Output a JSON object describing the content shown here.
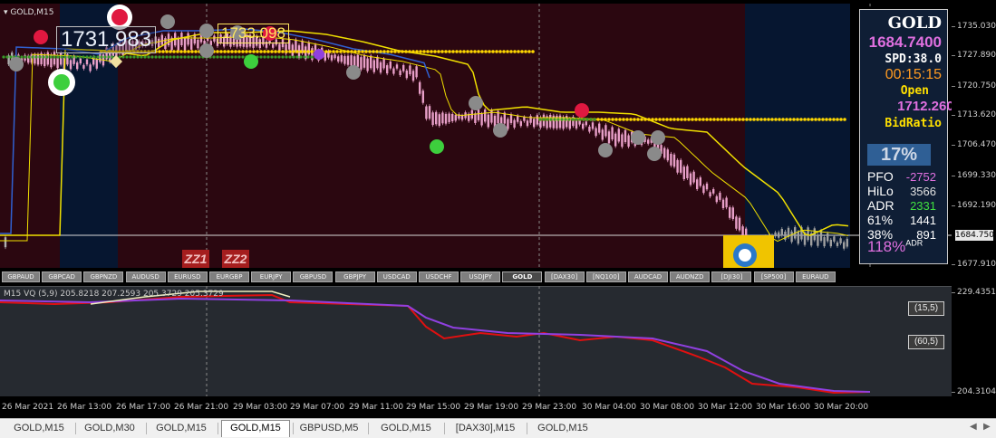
{
  "chart_title": "GOLD,M15",
  "price_ticks": [
    "1735.030",
    "1727.890",
    "1720.750",
    "1713.620",
    "1706.470",
    "1699.330",
    "1692.190",
    "1684.750",
    "1677.910"
  ],
  "current_price": "1684.750",
  "osc_ticks": [
    "229.4351",
    "204.3104"
  ],
  "overlay_prices": {
    "left": "1731.983",
    "mid": "1733.098"
  },
  "zz_labels": [
    "ZZ1",
    "ZZ2"
  ],
  "info_panel": {
    "symbol": "GOLD",
    "bid": "1684.7400",
    "spread": "SPD:38.0",
    "timer": "00:15:15",
    "open_label": "Open",
    "open_price": "1712.2600",
    "ratio_label": "BidRatio",
    "ratio_value": "17%",
    "stats": [
      {
        "label": "PFO",
        "value": "-2752",
        "color": "#e070e0"
      },
      {
        "label": "HiLo",
        "value": "3566",
        "color": "#e0e0e0"
      },
      {
        "label": "ADR",
        "value": "2331",
        "color": "#40e040"
      },
      {
        "label": "61%",
        "value": "1441",
        "color": "#ffffff"
      },
      {
        "label": "38%",
        "value": "891",
        "color": "#ffffff"
      }
    ],
    "adr_pct": "118%",
    "adr_suffix": "ADR"
  },
  "symbol_buttons": [
    "GBPAUD",
    "GBPCAD",
    "GBPNZD",
    "AUDUSD",
    "EURUSD",
    "EURGBP",
    "EURJPY",
    "GBPUSD",
    "GBPJPY",
    "USDCAD",
    "USDCHF",
    "USDJPY",
    "GOLD",
    "[DAX30]",
    "[NQ100]",
    "AUDCAD",
    "AUDNZD",
    "[DJI30]",
    "[SP500]",
    "EURAUD"
  ],
  "active_symbol": "GOLD",
  "osc_title": "M15 VQ (5,9) 205.8218 207.2593 205.3729 205.3729",
  "osc_labels": [
    "(15,5)",
    "(60,5)"
  ],
  "time_labels": [
    "26 Mar 2021",
    "26 Mar 13:00",
    "26 Mar 17:00",
    "26 Mar 21:00",
    "29 Mar 03:00",
    "29 Mar 07:00",
    "29 Mar 11:00",
    "29 Mar 15:00",
    "29 Mar 19:00",
    "29 Mar 23:00",
    "30 Mar 04:00",
    "30 Mar 08:00",
    "30 Mar 12:00",
    "30 Mar 16:00",
    "30 Mar 20:00"
  ],
  "tabs": [
    "GOLD,M15",
    "GOLD,M30",
    "GOLD,M15",
    "GOLD,M15",
    "GBPUSD,M5",
    "GOLD,M15",
    "[DAX30],M15",
    "GOLD,M15"
  ],
  "active_tab": 3,
  "colors": {
    "bg_bear": "#2b0710",
    "bg_bull": "#061630",
    "candle": "#e89fc8",
    "yellow_line": "#f0e000",
    "blue_line": "#3060d0",
    "green_dots": "#3a9a2a",
    "yellow_dots": "#ffd800",
    "osc_red": "#e01010",
    "osc_purple": "#9040e0"
  }
}
